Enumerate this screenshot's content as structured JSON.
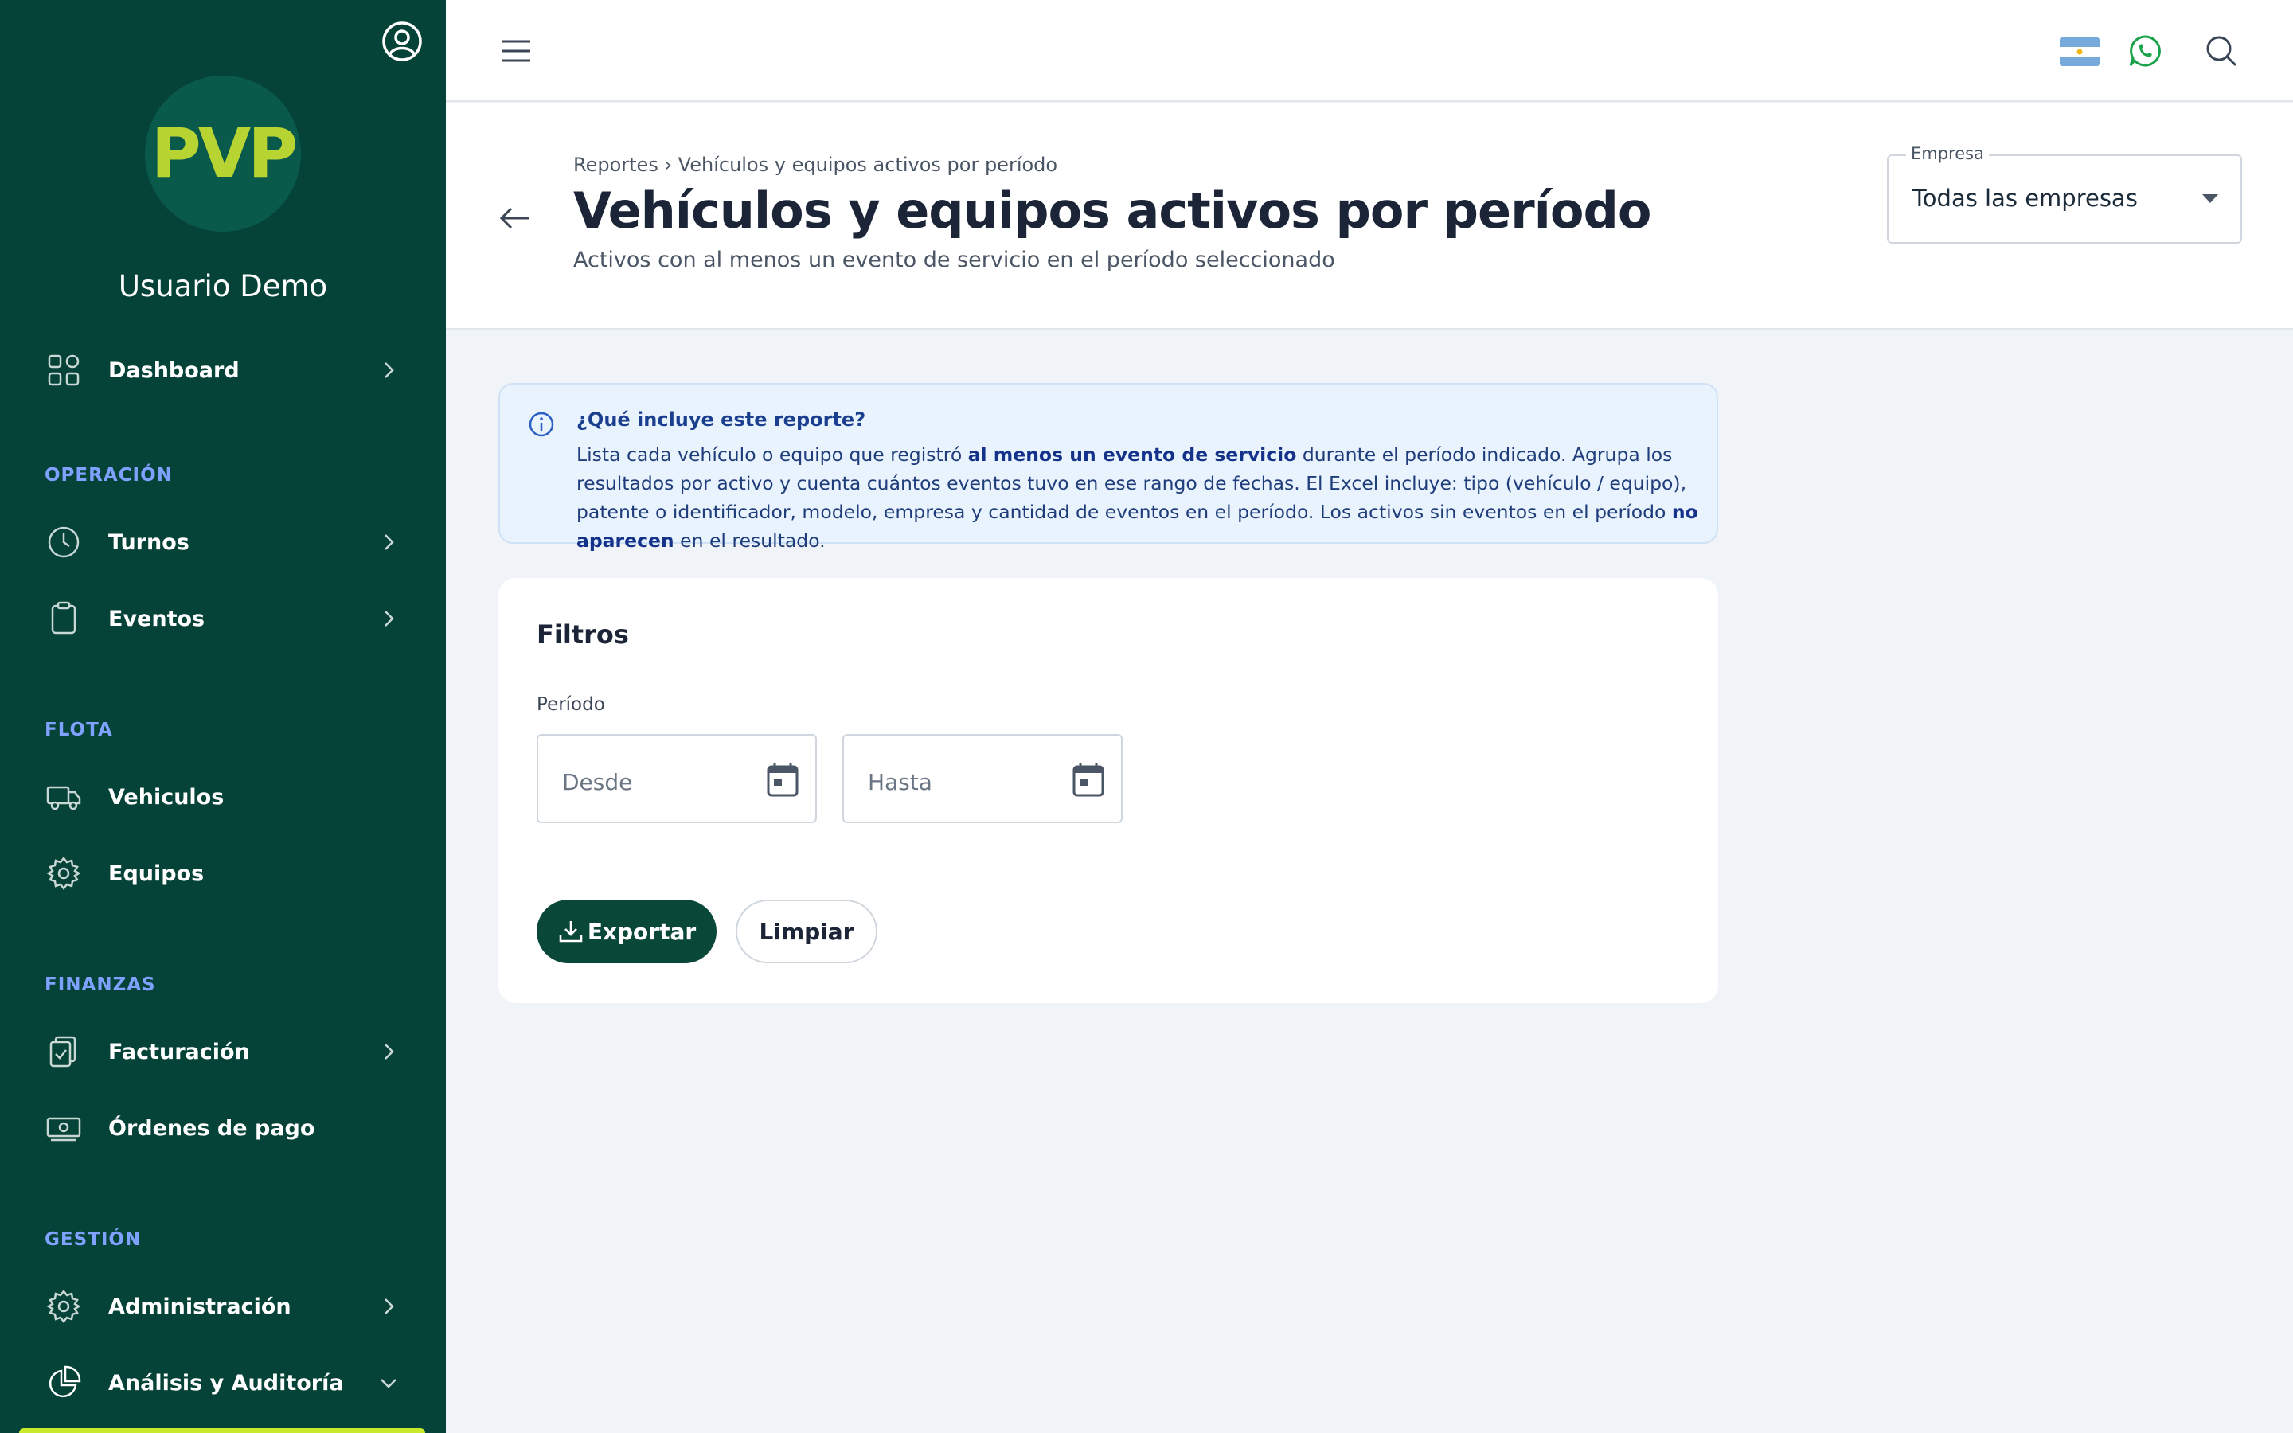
{
  "sidebar": {
    "logo_text": "PVP",
    "username": "Usuario Demo",
    "items": [
      {
        "label": "Dashboard"
      },
      {
        "label": "Turnos"
      },
      {
        "label": "Eventos"
      },
      {
        "label": "Vehiculos"
      },
      {
        "label": "Equipos"
      },
      {
        "label": "Facturación"
      },
      {
        "label": "Órdenes de pago"
      },
      {
        "label": "Administración"
      },
      {
        "label": "Análisis y Auditoría"
      }
    ],
    "sections": [
      "OPERACIÓN",
      "FLOTA",
      "FINANZAS",
      "GESTIÓN"
    ]
  },
  "topbar": {
    "icons": [
      "menu-icon",
      "argentina-flag-icon",
      "whatsapp-icon",
      "search-icon"
    ]
  },
  "header": {
    "breadcrumb": "Reportes › Vehículos y equipos activos por período",
    "title": "Vehículos y equipos activos por período",
    "subtitle": "Activos con al menos un evento de servicio en el período seleccionado",
    "empresa_label": "Empresa",
    "empresa_value": "Todas las empresas"
  },
  "info": {
    "title": "¿Qué incluye este reporte?",
    "text_1": "Lista cada vehículo o equipo que registró ",
    "bold_1": "al menos un evento de servicio",
    "text_2": " durante el período indicado. Agrupa los resultados por activo y cuenta cuántos eventos tuvo en ese rango de fechas. El Excel incluye: tipo (vehículo / equipo), patente o identificador, modelo, empresa y cantidad de eventos en el período. Los activos sin eventos en el período ",
    "bold_2": "no aparecen",
    "text_3": " en el resultado."
  },
  "filters": {
    "title": "Filtros",
    "period_label": "Período",
    "from_placeholder": "Desde",
    "to_placeholder": "Hasta",
    "export_label": "Exportar",
    "clear_label": "Limpiar"
  },
  "colors": {
    "sidebar_bg": "#054237",
    "accent_lime": "#c9ea2a",
    "section_blue": "#7fa1ff",
    "primary_button": "#094739"
  }
}
